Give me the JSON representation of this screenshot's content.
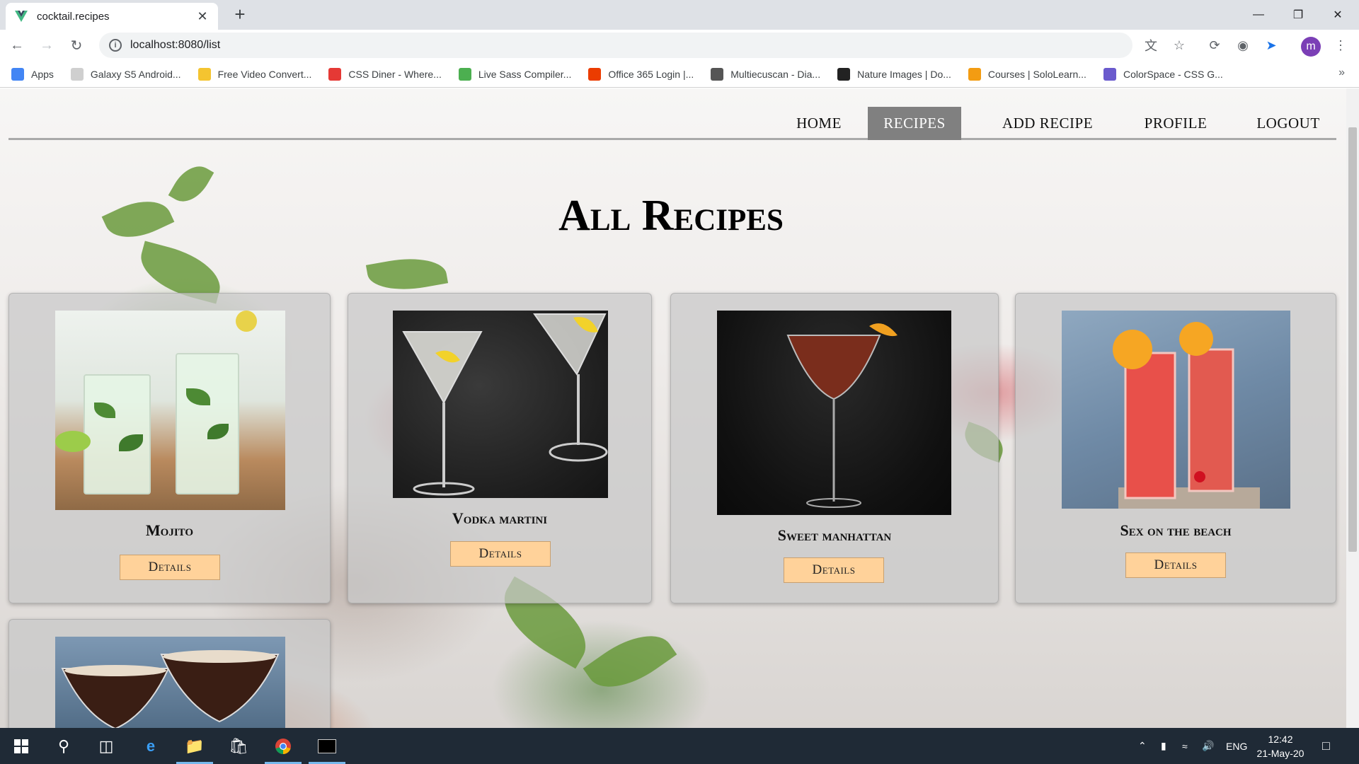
{
  "browser": {
    "tab_title": "cocktail.recipes",
    "url": "localhost:8080/list",
    "avatar_letter": "m",
    "bookmarks": [
      {
        "label": "Apps",
        "color": "#4285f4"
      },
      {
        "label": "Galaxy S5 Android...",
        "color": "#cfcfcf"
      },
      {
        "label": "Free Video Convert...",
        "color": "#f4c430"
      },
      {
        "label": "CSS Diner - Where...",
        "color": "#e53935"
      },
      {
        "label": "Live Sass Compiler...",
        "color": "#4caf50"
      },
      {
        "label": "Office 365 Login |...",
        "color": "#eb3c00"
      },
      {
        "label": "Multiecuscan - Dia...",
        "color": "#555555"
      },
      {
        "label": "Nature Images | Do...",
        "color": "#222222"
      },
      {
        "label": "Courses | SoloLearn...",
        "color": "#f39c12"
      },
      {
        "label": "ColorSpace - CSS G...",
        "color": "#6a5acd"
      }
    ],
    "bookmarks_more": "»"
  },
  "nav": {
    "items": [
      {
        "label": "HOME",
        "active": false
      },
      {
        "label": "RECIPES",
        "active": true
      },
      {
        "label": "ADD RECIPE",
        "active": false
      },
      {
        "label": "PROFILE",
        "active": false
      },
      {
        "label": "LOGOUT",
        "active": false
      }
    ]
  },
  "page": {
    "title": "All Recipes"
  },
  "recipes": [
    {
      "name": "Mojito",
      "button": "Details"
    },
    {
      "name": "Vodka martini",
      "button": "Details"
    },
    {
      "name": "Sweet manhattan",
      "button": "Details"
    },
    {
      "name": "Sex on the beach",
      "button": "Details"
    },
    {
      "name": "",
      "button": ""
    }
  ],
  "taskbar": {
    "language": "ENG",
    "time": "12:42",
    "date": "21-May-20"
  },
  "colors": {
    "nav_active_bg": "#808080",
    "details_button_bg": "#ffd29a",
    "taskbar_bg": "#1f2a36",
    "avatar_bg": "#7b3fb6"
  }
}
